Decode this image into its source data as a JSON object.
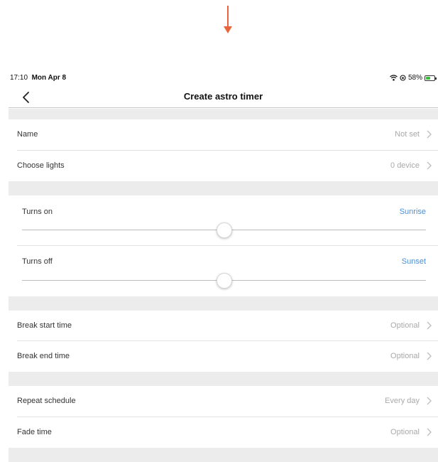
{
  "status": {
    "time": "17:10",
    "date": "Mon Apr 8",
    "battery": "58%",
    "battery_level": 0.58
  },
  "nav": {
    "title": "Create astro timer"
  },
  "settings": {
    "name": {
      "label": "Name",
      "value": "Not set"
    },
    "lights": {
      "label": "Choose lights",
      "value": "0 device"
    },
    "turns_on": {
      "label": "Turns on",
      "value": "Sunrise",
      "position": 0.5
    },
    "turns_off": {
      "label": "Turns off",
      "value": "Sunset",
      "position": 0.5
    },
    "break_start": {
      "label": "Break start time",
      "value": "Optional"
    },
    "break_end": {
      "label": "Break end time",
      "value": "Optional"
    },
    "repeat": {
      "label": "Repeat schedule",
      "value": "Every day"
    },
    "fade": {
      "label": "Fade time",
      "value": "Optional"
    }
  },
  "colors": {
    "accent": "#4a90d9",
    "arrow": "#e8643a",
    "section_gap": "#ececec"
  }
}
